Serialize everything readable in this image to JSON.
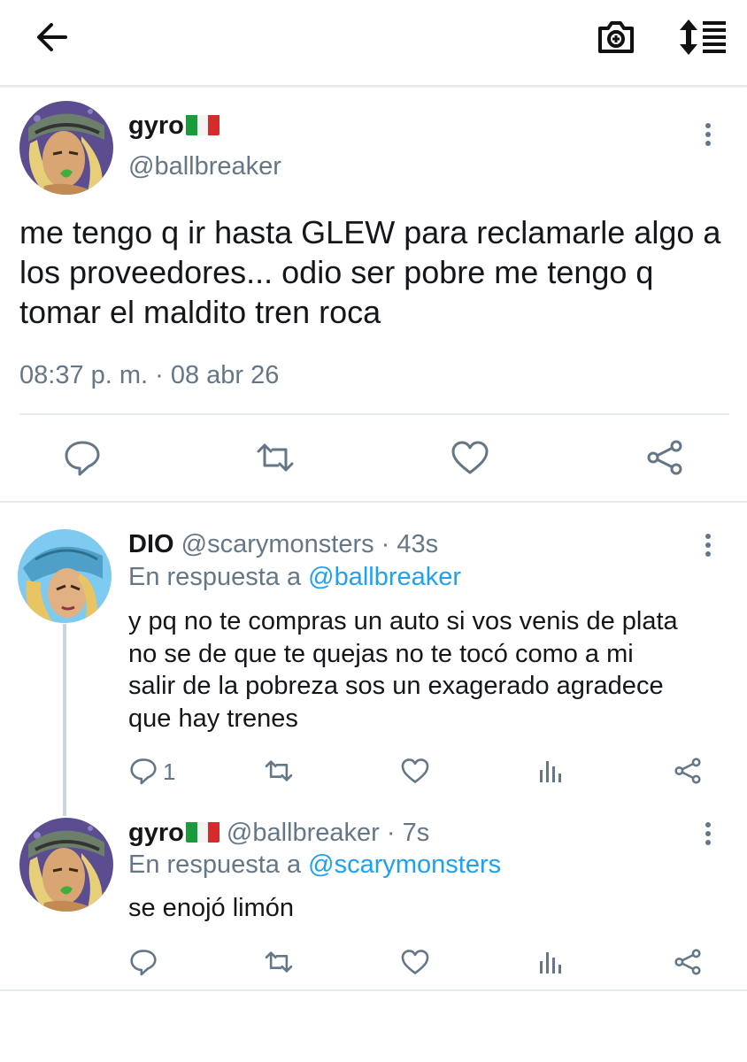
{
  "header": {
    "back_icon": "arrow-left-icon",
    "camera_icon": "add-photo-icon",
    "sort_icon": "sort-icon"
  },
  "tweet": {
    "name": "gyro",
    "flag": "🇮🇹",
    "handle": "@ballbreaker",
    "text": "me tengo q ir hasta GLEW para reclamarle algo a los proveedores... odio ser pobre me tengo q tomar el maldito tren roca",
    "timestamp": "08:37 p. m. · 08 abr 26",
    "actions": [
      "reply-icon",
      "retweet-icon",
      "like-icon",
      "share-icon"
    ]
  },
  "replies": [
    {
      "name": "DIO",
      "handle": "@scarymonsters",
      "age": "· 43s",
      "reply_prefix": "En respuesta a",
      "reply_to": "@ballbreaker",
      "lines": [
        "y pq no te compras un auto si vos venis de plata",
        "no se de que te quejas no te tocó como a mi",
        "salir de la pobreza sos un exagerado agradece",
        "que hay trenes"
      ],
      "reply_count": "1"
    },
    {
      "name": "gyro",
      "flag": "🇮🇹",
      "handle": "@ballbreaker",
      "age": "· 7s",
      "reply_prefix": "En respuesta a",
      "reply_to": "@scarymonsters",
      "lines": [
        "se enojó limón"
      ],
      "reply_count": ""
    }
  ],
  "colors": {
    "primary_text": "#14171a",
    "secondary_text": "#657786",
    "accent": "#1da1f2",
    "divider": "#e6ecf0"
  }
}
